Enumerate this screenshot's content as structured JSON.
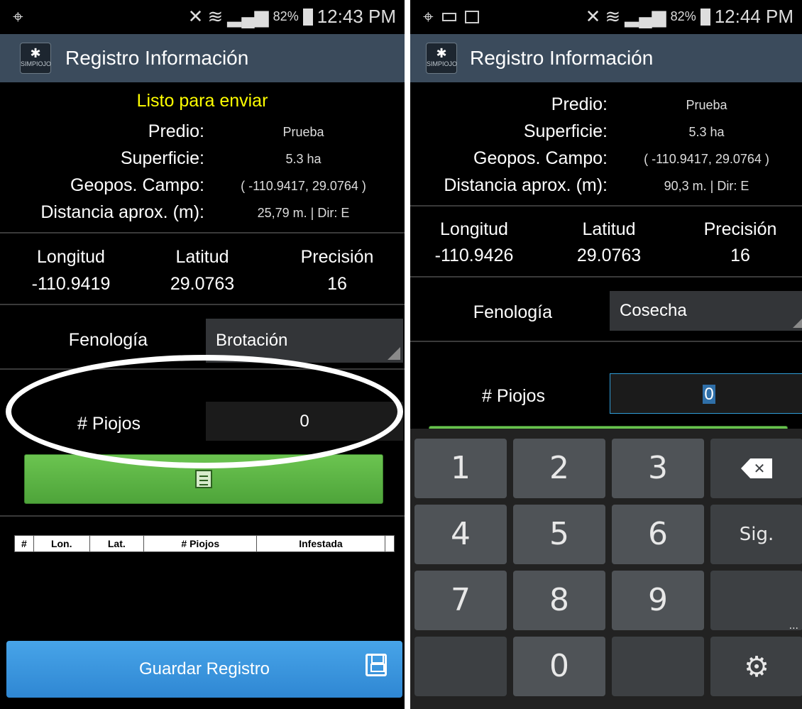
{
  "left": {
    "status": {
      "battery": "82%",
      "time": "12:43 PM"
    },
    "app_title": "Registro Información",
    "logo_text": "SIMPIOJO",
    "ready_text": "Listo para enviar",
    "fields": {
      "predio_label": "Predio:",
      "predio_value": "Prueba",
      "superficie_label": "Superficie:",
      "superficie_value": "5.3 ha",
      "geopos_label": "Geopos. Campo:",
      "geopos_value": "( -110.9417, 29.0764 )",
      "distancia_label": "Distancia aprox. (m):",
      "distancia_value": "25,79 m. | Dir: E"
    },
    "coords": {
      "lon_label": "Longitud",
      "lon_value": "-110.9419",
      "lat_label": "Latitud",
      "lat_value": "29.0763",
      "prec_label": "Precisión",
      "prec_value": "16"
    },
    "fenologia_label": "Fenología",
    "fenologia_value": "Brotación",
    "piojos_label": "# Piojos",
    "piojos_value": "0",
    "table_headers": [
      "#",
      "Lon.",
      "Lat.",
      "# Piojos",
      "Infestada"
    ],
    "save_label": "Guardar Registro"
  },
  "right": {
    "status": {
      "battery": "82%",
      "time": "12:44 PM"
    },
    "app_title": "Registro Información",
    "logo_text": "SIMPIOJO",
    "fields": {
      "predio_label": "Predio:",
      "predio_value": "Prueba",
      "superficie_label": "Superficie:",
      "superficie_value": "5.3 ha",
      "geopos_label": "Geopos. Campo:",
      "geopos_value": "( -110.9417, 29.0764 )",
      "distancia_label": "Distancia aprox. (m):",
      "distancia_value": "90,3 m. | Dir: E"
    },
    "coords": {
      "lon_label": "Longitud",
      "lon_value": "-110.9426",
      "lat_label": "Latitud",
      "lat_value": "29.0763",
      "prec_label": "Precisión",
      "prec_value": "16"
    },
    "fenologia_label": "Fenología",
    "fenologia_value": "Cosecha",
    "piojos_label": "# Piojos",
    "piojos_value": "0",
    "keys": {
      "k1": "1",
      "k2": "2",
      "k3": "3",
      "k4": "4",
      "k5": "5",
      "k6": "6",
      "next": "Sig.",
      "k7": "7",
      "k8": "8",
      "k9": "9",
      "k0": "0",
      "more": "..."
    }
  },
  "colors": {
    "actionbar": "#3b4b5c",
    "ready": "#ffff00",
    "green_button": "#5cb646",
    "blue_button": "#3a93dc"
  },
  "icons": [
    "gps-icon",
    "signal-icon",
    "wifi-icon",
    "battery-icon",
    "keyboard-icon",
    "image-icon",
    "clipboard-icon",
    "floppy-disk-icon",
    "backspace-icon",
    "gear-icon"
  ]
}
